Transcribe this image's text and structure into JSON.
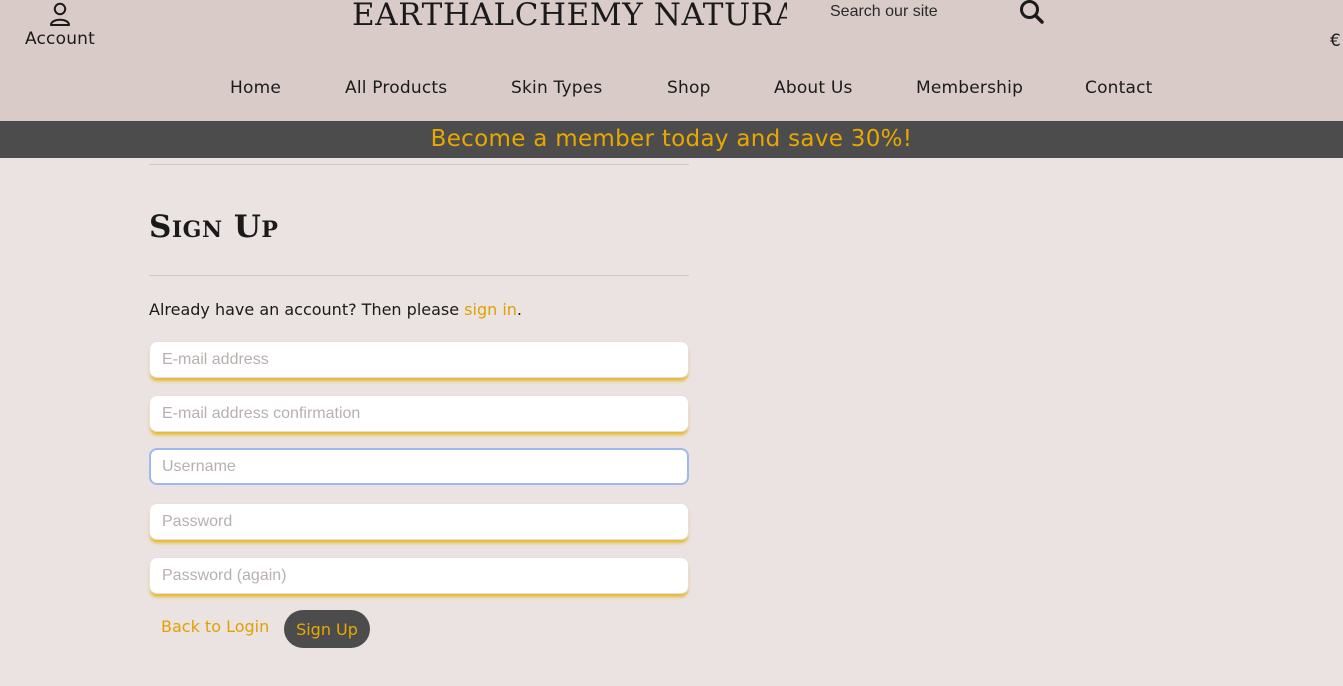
{
  "header": {
    "account_label": "Account",
    "logo_text": "EARTHALCHEMY NATURALS",
    "search": {
      "placeholder": "Search our site",
      "value": ""
    },
    "currency_symbol": "€"
  },
  "nav": {
    "items": [
      {
        "label": "Home"
      },
      {
        "label": "All Products"
      },
      {
        "label": "Skin Types"
      },
      {
        "label": "Shop"
      },
      {
        "label": "About Us"
      },
      {
        "label": "Membership"
      },
      {
        "label": "Contact"
      }
    ]
  },
  "banner": {
    "text": "Become a member today and save 30%!"
  },
  "signup": {
    "title": "Sign Up",
    "intro_prefix": "Already have an account? Then please ",
    "intro_link": "sign in",
    "intro_suffix": ".",
    "fields": {
      "email": {
        "placeholder": "E-mail address"
      },
      "email_confirm": {
        "placeholder": "E-mail address confirmation"
      },
      "username": {
        "placeholder": "Username"
      },
      "password": {
        "placeholder": "Password"
      },
      "password_again": {
        "placeholder": "Password (again)"
      }
    },
    "back_link": "Back to Login",
    "submit_label": "Sign Up"
  },
  "colors": {
    "header_bg": "#d8cbc8",
    "page_bg": "#ebe3e2",
    "banner_bg": "#4c4c4c",
    "accent": "#e9a800"
  },
  "icons": {
    "account": "user-outline-icon",
    "search": "magnifier-icon"
  }
}
